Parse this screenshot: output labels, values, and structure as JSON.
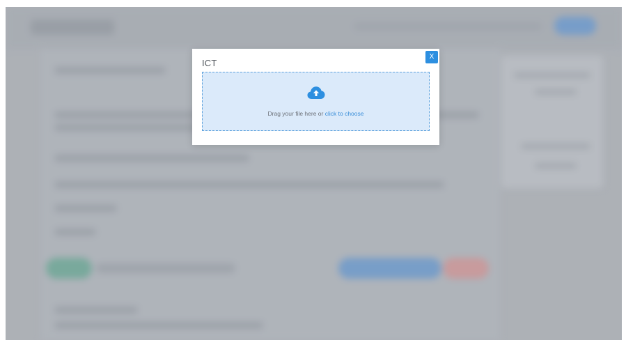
{
  "modal": {
    "title": "ICT",
    "close_label": "X",
    "dropzone": {
      "icon": "cloud-upload-icon",
      "prompt_text": "Drag your file here or",
      "link_text": "click to choose"
    }
  },
  "colors": {
    "accent": "#2d8fe0",
    "dropzone_bg": "#dbeafa",
    "dropzone_border": "#5aa0dc",
    "link": "#3b8fd9"
  }
}
